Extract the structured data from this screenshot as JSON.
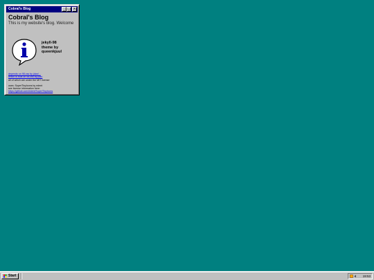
{
  "window": {
    "title": "Cobral's Blog",
    "controls": {
      "minimize": "_",
      "maximize": "□",
      "close": "×"
    }
  },
  "content": {
    "heading": "Cobral's Blog",
    "subtitle": "This is my website's blog. Welcome",
    "theme_lines": [
      "jekyll-98",
      "theme by",
      "queenkjuul"
    ],
    "links": [
      "depends on 98.css by jdan/...",
      "which is built on 98.css by jdan",
      "all of which are under the MIT license"
    ],
    "credits": [
      "uses: SuperTinyIcons by edent",
      "see license information here:",
      "https://github.com/edent/SuperTinyIcons"
    ]
  },
  "taskbar": {
    "start_label": "Start",
    "clock": "19:53"
  },
  "colors": {
    "desktop": "#008080",
    "titlebar": "#000080",
    "window_face": "#c0c0c0",
    "link": "#0000ee"
  }
}
